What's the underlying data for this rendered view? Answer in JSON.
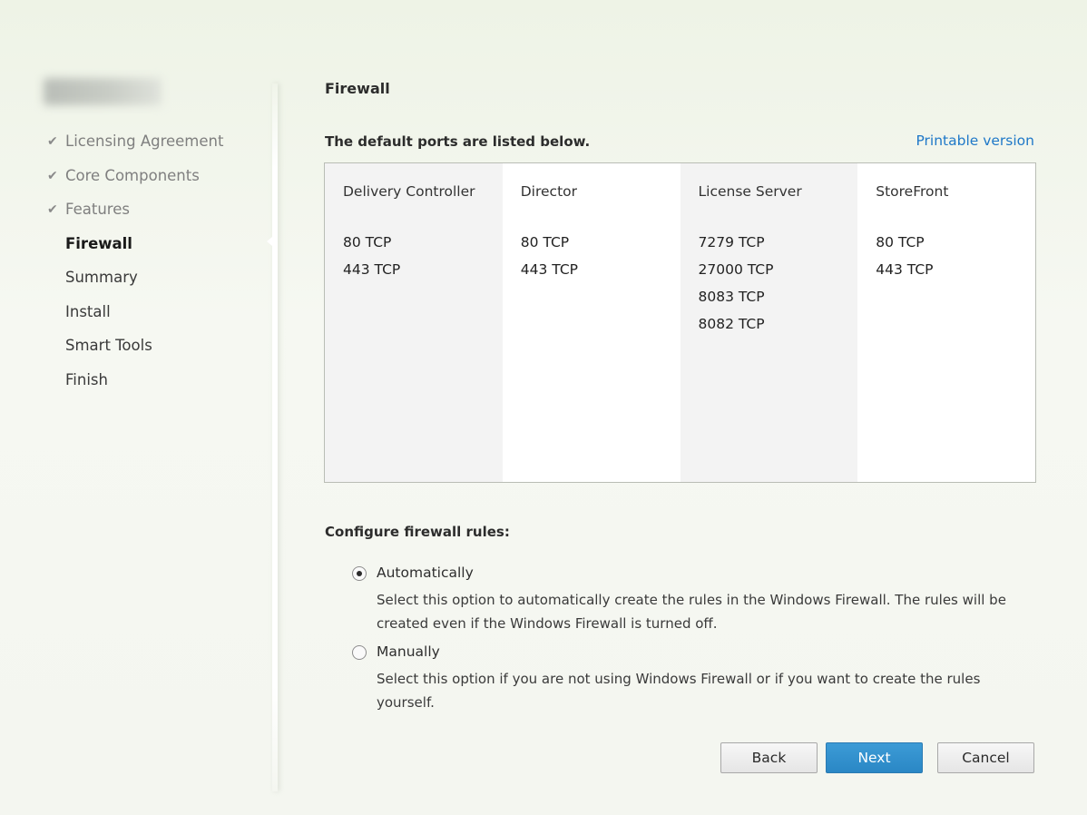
{
  "sidebar": {
    "items": [
      {
        "label": "Licensing Agreement",
        "state": "done",
        "check": "✔"
      },
      {
        "label": "Core Components",
        "state": "done",
        "check": "✔"
      },
      {
        "label": "Features",
        "state": "done",
        "check": "✔"
      },
      {
        "label": "Firewall",
        "state": "current",
        "check": ""
      },
      {
        "label": "Summary",
        "state": "pending",
        "check": ""
      },
      {
        "label": "Install",
        "state": "pending",
        "check": ""
      },
      {
        "label": "Smart Tools",
        "state": "pending",
        "check": ""
      },
      {
        "label": "Finish",
        "state": "pending",
        "check": ""
      }
    ]
  },
  "main": {
    "title": "Firewall",
    "subhead": "The default ports are listed below.",
    "printable_link": "Printable version",
    "ports": [
      {
        "component": "Delivery Controller",
        "ports": [
          "80 TCP",
          "443 TCP"
        ]
      },
      {
        "component": "Director",
        "ports": [
          "80 TCP",
          "443 TCP"
        ]
      },
      {
        "component": "License Server",
        "ports": [
          "7279 TCP",
          "27000 TCP",
          "8083 TCP",
          "8082 TCP"
        ]
      },
      {
        "component": "StoreFront",
        "ports": [
          "80 TCP",
          "443 TCP"
        ]
      }
    ],
    "config_label": "Configure firewall rules:",
    "options": {
      "auto": {
        "label": "Automatically",
        "selected": true,
        "description": "Select this option to automatically create the rules in the Windows Firewall.  The rules will be created even if the Windows Firewall is turned off."
      },
      "manual": {
        "label": "Manually",
        "selected": false,
        "description": "Select this option if you are not using Windows Firewall or if you want to create the rules yourself."
      }
    }
  },
  "buttons": {
    "back": "Back",
    "next": "Next",
    "cancel": "Cancel"
  },
  "colors": {
    "link": "#1f78c8",
    "primary_button": "#2a87c5"
  }
}
